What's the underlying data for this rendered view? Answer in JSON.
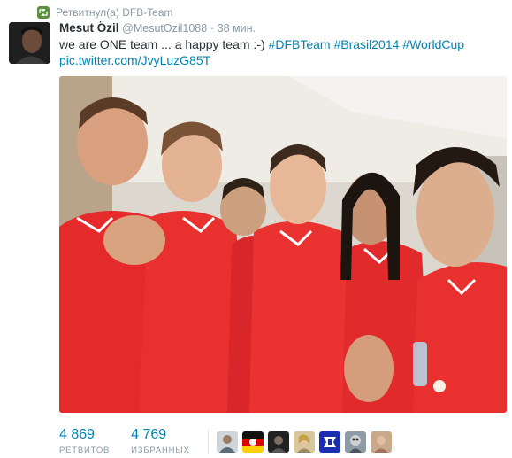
{
  "retweet": {
    "text": "Ретвитнул(а) DFB-Team",
    "icon": "retweet-icon"
  },
  "tweet": {
    "fullname": "Mesut Özil",
    "username": "@MesutOzil1088",
    "separator": "·",
    "time": "38 мин.",
    "text_plain": "we are ONE team ... a happy team :-) ",
    "hashtags": [
      "#DFBTeam",
      "#Brasil2014",
      "#WorldCup"
    ],
    "link": "pic.twitter.com/JvyLuzG85T"
  },
  "stats": {
    "retweets": {
      "count": "4 869",
      "label": "РЕТВИТОВ"
    },
    "favorites": {
      "count": "4 769",
      "label": "ИЗБРАННЫХ"
    }
  },
  "colors": {
    "link": "#0084b4",
    "muted": "#8899a6",
    "text": "#292f33",
    "jersey": "#e8252e"
  }
}
